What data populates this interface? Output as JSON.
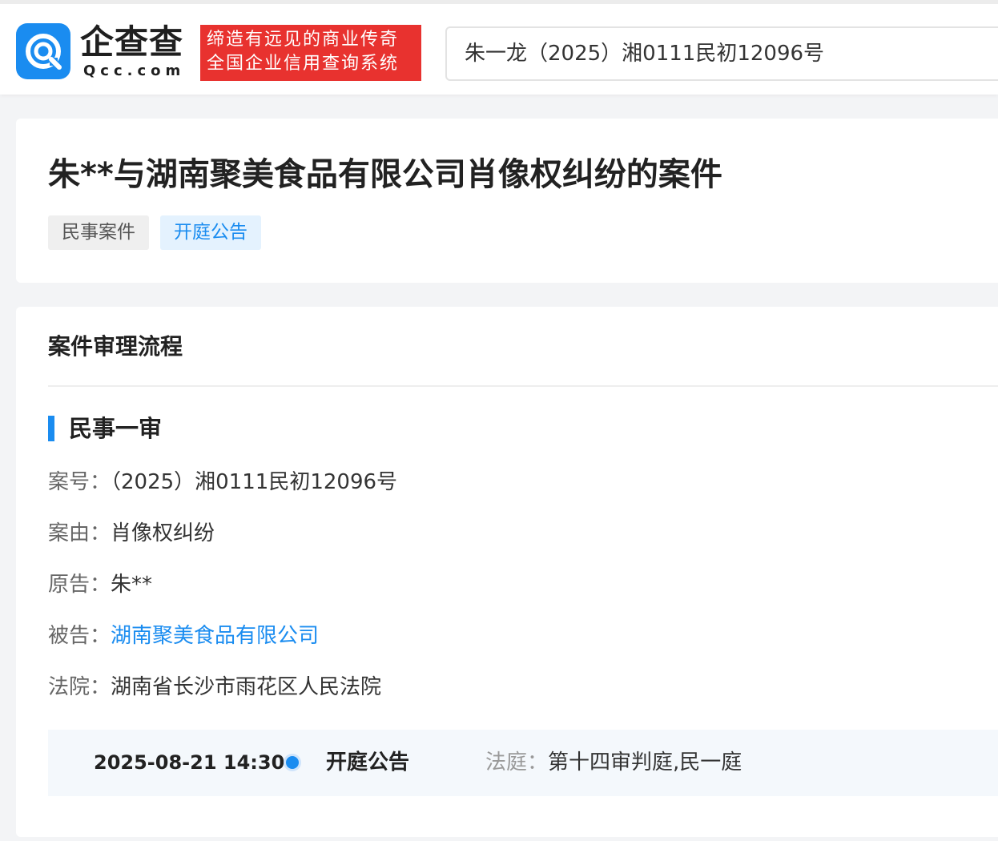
{
  "header": {
    "logo_name": "企查查",
    "logo_domain": "Qcc.com",
    "slogan_line1": "缔造有远见的商业传奇",
    "slogan_line2": "全国企业信用查询系统",
    "search_value": "朱一龙（2025）湘0111民初12096号"
  },
  "case": {
    "title": "朱**与湖南聚美食品有限公司肖像权纠纷的案件",
    "tags": [
      "民事案件",
      "开庭公告"
    ]
  },
  "process": {
    "section_title": "案件审理流程",
    "stage_title": "民事一审",
    "fields": [
      {
        "label": "案号：",
        "value": "（2025）湘0111民初12096号"
      },
      {
        "label": "案由：",
        "value": "肖像权纠纷"
      },
      {
        "label": "原告：",
        "value": "朱**"
      },
      {
        "label": "被告：",
        "value": "湖南聚美食品有限公司"
      },
      {
        "label": "法院：",
        "value": "湖南省长沙市雨花区人民法院"
      }
    ],
    "timeline": {
      "datetime": "2025-08-21 14:30",
      "event": "开庭公告",
      "court_label": "法庭：",
      "court_value": "第十四审判庭,民一庭"
    }
  },
  "colors": {
    "brand_blue": "#1a8cf0",
    "slogan_red": "#e8322f"
  },
  "icons": {
    "logo": "qcc-logo-icon"
  }
}
